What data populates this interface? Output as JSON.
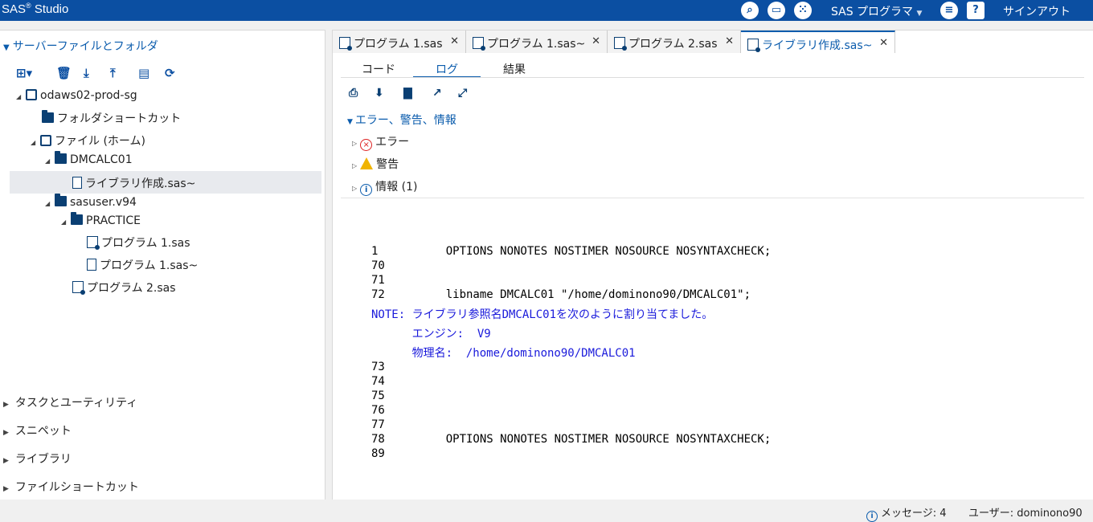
{
  "topbar": {
    "brand": "SAS",
    "brand_reg": "®",
    "brand_suffix": "Studio",
    "menu_label": "SAS プログラマ",
    "signout": "サインアウト"
  },
  "left": {
    "section_title": "サーバーファイルとフォルダ",
    "tree": {
      "server": "odaws02-prod-sg",
      "folder_shortcut": "フォルダショートカット",
      "files_home": "ファイル (ホーム)",
      "dmcalc01": "DMCALC01",
      "lib_file": "ライブラリ作成.sas~",
      "sasuser": "sasuser.v94",
      "practice": "PRACTICE",
      "prog1": "プログラム 1.sas",
      "prog1_tilde": "プログラム 1.sas~",
      "prog2": "プログラム 2.sas"
    },
    "accordion": [
      "タスクとユーティリティ",
      "スニペット",
      "ライブラリ",
      "ファイルショートカット"
    ]
  },
  "tabs": [
    {
      "label": "プログラム 1.sas"
    },
    {
      "label": "プログラム 1.sas~"
    },
    {
      "label": "プログラム 2.sas"
    },
    {
      "label": "ライブラリ作成.sas~"
    }
  ],
  "subtabs": [
    "コード",
    "ログ",
    "結果"
  ],
  "log": {
    "section": "エラー、警告、情報",
    "errors": "エラー",
    "warnings": "警告",
    "info": "情報 (1)"
  },
  "code_lines": [
    "1          OPTIONS NONOTES NOSTIMER NOSOURCE NOSYNTAXCHECK;",
    "70",
    "71",
    "72         libname DMCALC01 \"/home/dominono90/DMCALC01\";",
    "NOTE: ライブラリ参照名DMCALC01を次のように割り当てました。",
    "      エンジン:  V9",
    "      物理名:  /home/dominono90/DMCALC01",
    "73",
    "74",
    "75",
    "76",
    "77",
    "78         OPTIONS NONOTES NOSTIMER NOSOURCE NOSYNTAXCHECK;",
    "89"
  ],
  "status": {
    "messages": "メッセージ: 4",
    "user": "ユーザー: dominono90"
  }
}
